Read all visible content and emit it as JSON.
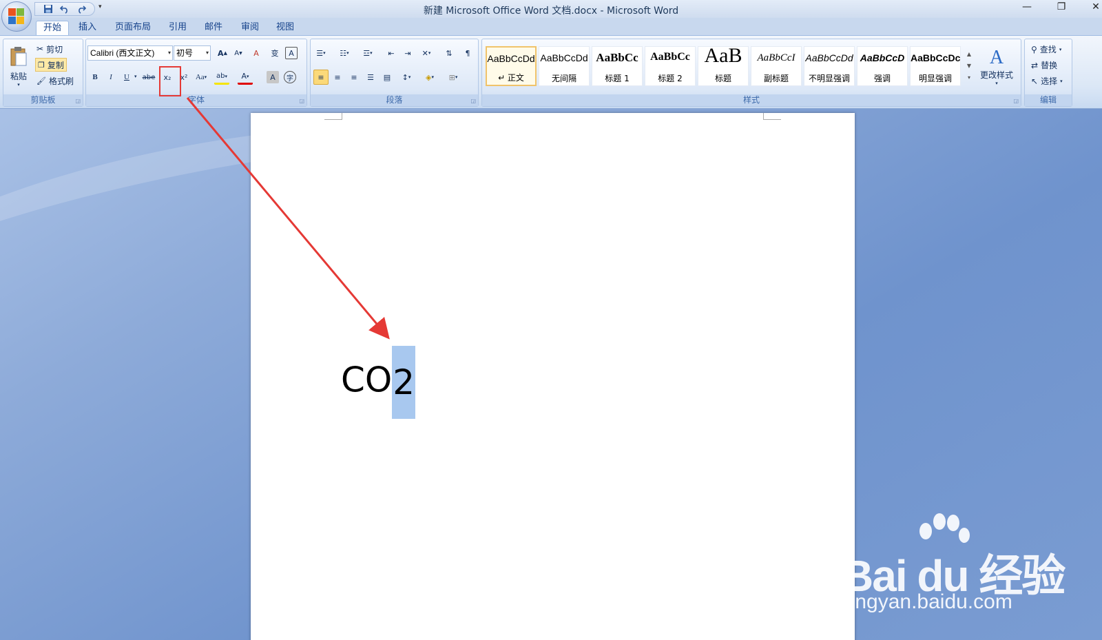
{
  "window": {
    "title": "新建 Microsoft Office Word 文档.docx - Microsoft Word",
    "minimize": "—",
    "restore": "❐",
    "close": "✕"
  },
  "quick_access": {
    "save_icon": "save-icon",
    "undo_icon": "undo-icon",
    "redo_icon": "redo-icon",
    "customize": "▾"
  },
  "tabs": [
    {
      "label": "开始",
      "active": true
    },
    {
      "label": "插入"
    },
    {
      "label": "页面布局"
    },
    {
      "label": "引用"
    },
    {
      "label": "邮件"
    },
    {
      "label": "审阅"
    },
    {
      "label": "视图"
    }
  ],
  "clipboard": {
    "label": "剪贴板",
    "paste": "粘贴",
    "cut": "剪切",
    "copy": "复制",
    "format_painter": "格式刷"
  },
  "font": {
    "label": "字体",
    "font_name": "Calibri (西文正文)",
    "font_size": "初号",
    "grow": "A",
    "shrink": "A",
    "clear": "A",
    "phonetic": "变",
    "border_char": "A",
    "bold": "B",
    "italic": "I",
    "underline": "U",
    "strike": "abe",
    "subscript": "x₂",
    "superscript": "x²",
    "change_case": "Aa",
    "highlight": "ab",
    "font_color": "A",
    "shading_char": "A",
    "enclose": "字"
  },
  "paragraph": {
    "label": "段落"
  },
  "styles": {
    "label": "样式",
    "items": [
      {
        "preview": "AaBbCcDd",
        "name": "↵ 正文"
      },
      {
        "preview": "AaBbCcDd",
        "name": "无间隔"
      },
      {
        "preview": "AaBbCc",
        "name": "标题 1"
      },
      {
        "preview": "AaBbCc",
        "name": "标题 2"
      },
      {
        "preview": "AaB",
        "name": "标题"
      },
      {
        "preview": "AaBbCcI",
        "name": "副标题"
      },
      {
        "preview": "AaBbCcDd",
        "name": "不明显强调"
      },
      {
        "preview": "AaBbCcD",
        "name": "强调"
      },
      {
        "preview": "AaBbCcDc",
        "name": "明显强调"
      }
    ],
    "change_styles": "更改样式"
  },
  "editing": {
    "label": "编辑",
    "find": "查找",
    "replace": "替换",
    "select": "选择"
  },
  "document": {
    "text_before": "CO",
    "selected_text": "2"
  },
  "watermark": {
    "brand": "Bai du 经验",
    "url": "jingyan.baidu.com"
  },
  "colors": {
    "annotation": "#e53935",
    "selection": "#a8c8ef"
  }
}
